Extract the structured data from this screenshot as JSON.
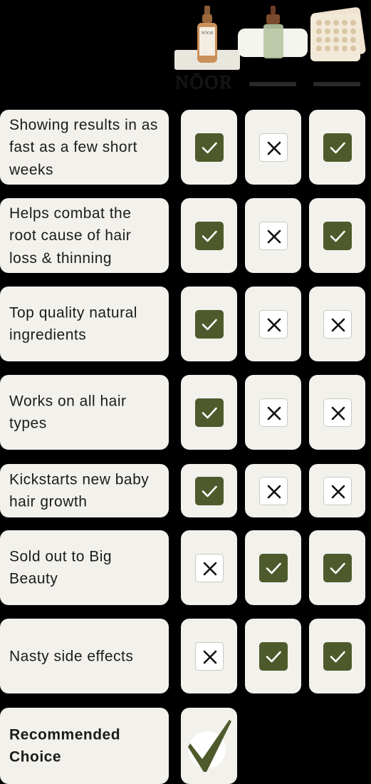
{
  "header": {
    "brand_main": "NŌOR",
    "product_main_label": "NŌOR"
  },
  "rows": [
    {
      "label": "Showing results in as fast as a few short weeks",
      "marks": [
        "yes",
        "no",
        "yes"
      ]
    },
    {
      "label": "Helps combat the root cause of hair loss & thinning",
      "marks": [
        "yes",
        "no",
        "yes"
      ]
    },
    {
      "label": "Top quality natural ingredients",
      "marks": [
        "yes",
        "no",
        "no"
      ]
    },
    {
      "label": "Works on all hair types",
      "marks": [
        "yes",
        "no",
        "no"
      ]
    },
    {
      "label": "Kickstarts new baby hair growth",
      "marks": [
        "yes",
        "no",
        "no"
      ]
    },
    {
      "label": "Sold out to Big Beauty",
      "marks": [
        "no",
        "yes",
        "yes"
      ]
    },
    {
      "label": "Nasty side effects",
      "marks": [
        "no",
        "yes",
        "yes"
      ]
    }
  ],
  "recommended": {
    "label": "Recommended Choice"
  },
  "colors": {
    "background": "#000000",
    "cell": "#f2f1ec",
    "check_fill": "#4e5a2c",
    "cross_fill": "#ffffff"
  },
  "icons": {
    "yes": "check-icon",
    "no": "cross-icon",
    "recommended": "big-check-icon"
  }
}
